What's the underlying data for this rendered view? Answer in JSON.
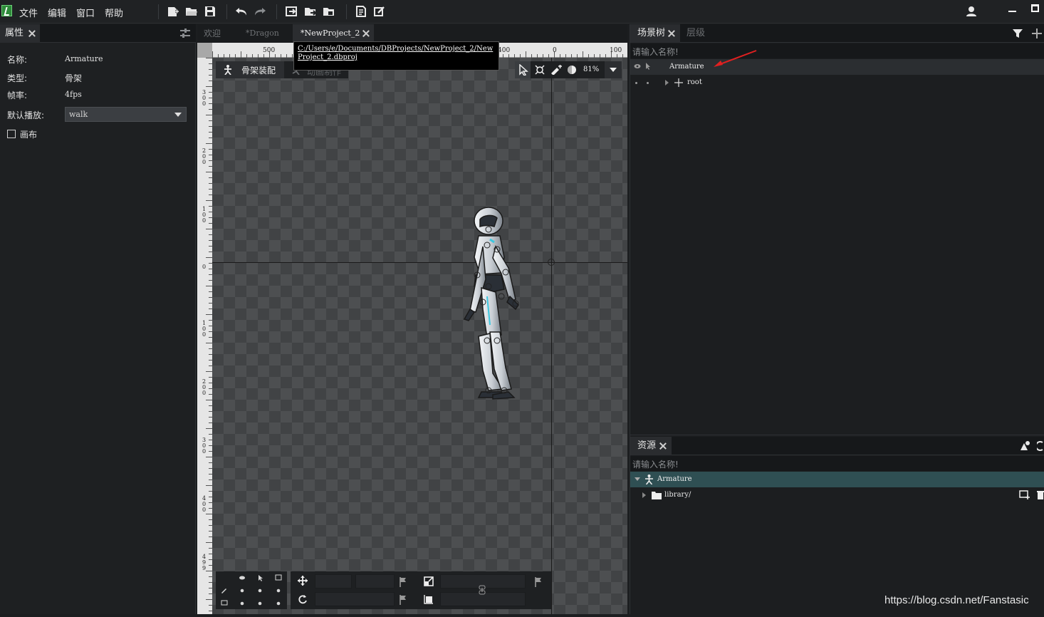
{
  "menubar": {
    "items": [
      "文件",
      "编辑",
      "窗口",
      "帮助"
    ]
  },
  "left_panel": {
    "tab_label": "属性",
    "props": [
      {
        "label": "名称:",
        "value": "Armature"
      },
      {
        "label": "类型:",
        "value": "骨架"
      },
      {
        "label": "帧率:",
        "value": "4fps"
      }
    ],
    "default_play_label": "默认播放:",
    "default_play_value": "walk",
    "canvas_label": "画布"
  },
  "doc_tabs": [
    {
      "label": "欢迎"
    },
    {
      "label": "*Dragon"
    },
    {
      "label": "*NewProject_2"
    }
  ],
  "tooltip": "C:/Users/e/Documents/DBProjects/NewProject_2/NewProject_2.dbproj",
  "mode_tabs": {
    "armature": "骨架装配",
    "animate": "动画制作"
  },
  "zoom": "81%",
  "ruler_top": [
    "500",
    "400",
    "0",
    "100"
  ],
  "ruler_left": [
    "300",
    "200",
    "100",
    "0",
    "100",
    "200",
    "300",
    "400",
    "499"
  ],
  "scene_tree": {
    "tab_label": "场景树",
    "tab2_label": "层级",
    "search_placeholder": "请输入名称!",
    "nodes": [
      {
        "label": "Armature"
      },
      {
        "label": "root"
      }
    ]
  },
  "assets": {
    "tab_label": "资源",
    "search_placeholder": "请输入名称!",
    "nodes": [
      {
        "label": "Armature"
      },
      {
        "label": "library/"
      }
    ]
  },
  "watermark": "https://blog.csdn.net/Fanstasic",
  "colors": {
    "accent_selected": "#2f4f53",
    "annotation_arrow": "#e02020"
  }
}
